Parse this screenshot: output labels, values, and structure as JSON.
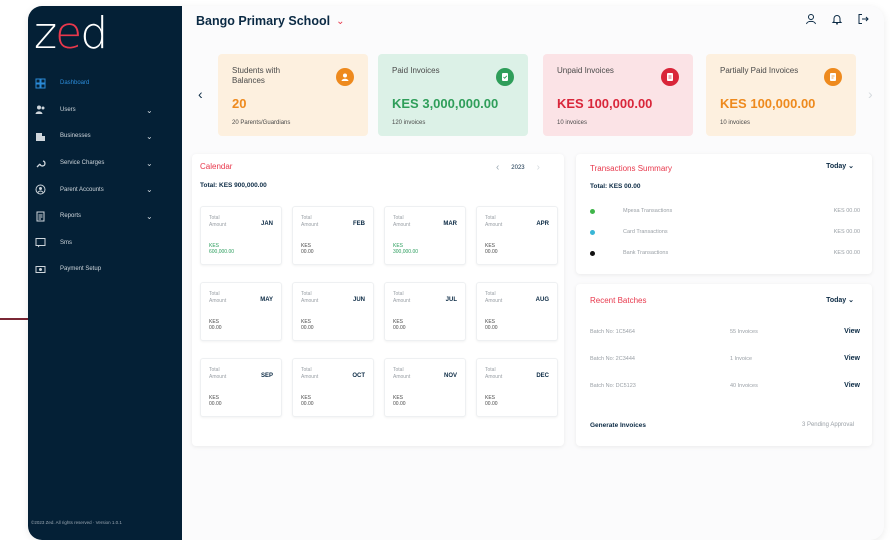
{
  "app": {
    "logo": "zed"
  },
  "sidebar": {
    "items": [
      {
        "label": "Dashboard",
        "icon": "dashboard-icon",
        "has_submenu": false,
        "active": true
      },
      {
        "label": "Users",
        "icon": "users-icon",
        "has_submenu": true
      },
      {
        "label": "Businesses",
        "icon": "businesses-icon",
        "has_submenu": true
      },
      {
        "label": "Service Charges",
        "icon": "service-charges-icon",
        "has_submenu": true
      },
      {
        "label": "Parent Accounts",
        "icon": "parent-accounts-icon",
        "has_submenu": true
      },
      {
        "label": "Reports",
        "icon": "reports-icon",
        "has_submenu": true
      },
      {
        "label": "Sms",
        "icon": "sms-icon",
        "has_submenu": false
      },
      {
        "label": "Payment Setup",
        "icon": "payment-setup-icon",
        "has_submenu": false
      }
    ],
    "copyright": "©2023 Zed. All rights reserved · Version 1.0.1"
  },
  "header": {
    "school_name": "Bango Primary School"
  },
  "stats": [
    {
      "title": "Students with Balances",
      "value": "20",
      "sub": "20 Parents/Guardians",
      "color": "#ee8a1e",
      "bg": "#fdf0df",
      "icon": "user-icon"
    },
    {
      "title": "Paid Invoices",
      "value": "KES 3,000,000.00",
      "sub": "120 invoices",
      "color": "#2f9e5a",
      "bg": "#dcf1e7",
      "icon": "paid-invoice-icon"
    },
    {
      "title": "Unpaid Invoices",
      "value": "KES 100,000.00",
      "sub": "10 invoices",
      "color": "#d9263a",
      "bg": "#fbe3e6",
      "icon": "unpaid-invoice-icon"
    },
    {
      "title": "Partially Paid Invoices",
      "value": "KES 100,000.00",
      "sub": "10 invoices",
      "color": "#ee8a1e",
      "bg": "#fdf0df",
      "icon": "partial-invoice-icon"
    }
  ],
  "calendar": {
    "title": "Calendar",
    "total": "Total: KES 900,000.00",
    "year": "2023",
    "amount_label": "Total Amount",
    "months": [
      {
        "name": "JAN",
        "currency": "KES",
        "amount": "600,000.00",
        "highlight": true
      },
      {
        "name": "FEB",
        "currency": "KES",
        "amount": "00.00",
        "highlight": false
      },
      {
        "name": "MAR",
        "currency": "KES",
        "amount": "300,000.00",
        "highlight": true
      },
      {
        "name": "APR",
        "currency": "KES",
        "amount": "00.00",
        "highlight": false
      },
      {
        "name": "MAY",
        "currency": "KES",
        "amount": "00.00",
        "highlight": false
      },
      {
        "name": "JUN",
        "currency": "KES",
        "amount": "00.00",
        "highlight": false
      },
      {
        "name": "JUL",
        "currency": "KES",
        "amount": "00.00",
        "highlight": false
      },
      {
        "name": "AUG",
        "currency": "KES",
        "amount": "00.00",
        "highlight": false
      },
      {
        "name": "SEP",
        "currency": "KES",
        "amount": "00.00",
        "highlight": false
      },
      {
        "name": "OCT",
        "currency": "KES",
        "amount": "00.00",
        "highlight": false
      },
      {
        "name": "NOV",
        "currency": "KES",
        "amount": "00.00",
        "highlight": false
      },
      {
        "name": "DEC",
        "currency": "KES",
        "amount": "00.00",
        "highlight": false
      }
    ]
  },
  "transactions": {
    "title": "Transactions Summary",
    "period": "Today",
    "total": "Total: KES 00.00",
    "rows": [
      {
        "name": "Mpesa Transactions",
        "amount": "KES 00.00",
        "color": "#3fb54a"
      },
      {
        "name": "Card Transactions",
        "amount": "KES 00.00",
        "color": "#39b6d6"
      },
      {
        "name": "Bank Transactions",
        "amount": "KES 00.00",
        "color": "#111111"
      }
    ]
  },
  "batches": {
    "title": "Recent Batches",
    "period": "Today",
    "rows": [
      {
        "batch": "Batch No: 1C5464",
        "invoices": "55 Invoices",
        "action": "View"
      },
      {
        "batch": "Batch No: 2C3444",
        "invoices": "1 Invoice",
        "action": "View"
      },
      {
        "batch": "Batch No: DC5123",
        "invoices": "40 Invoices",
        "action": "View"
      }
    ],
    "generate": "Generate Invoices",
    "pending": "3 Pending Approval"
  }
}
